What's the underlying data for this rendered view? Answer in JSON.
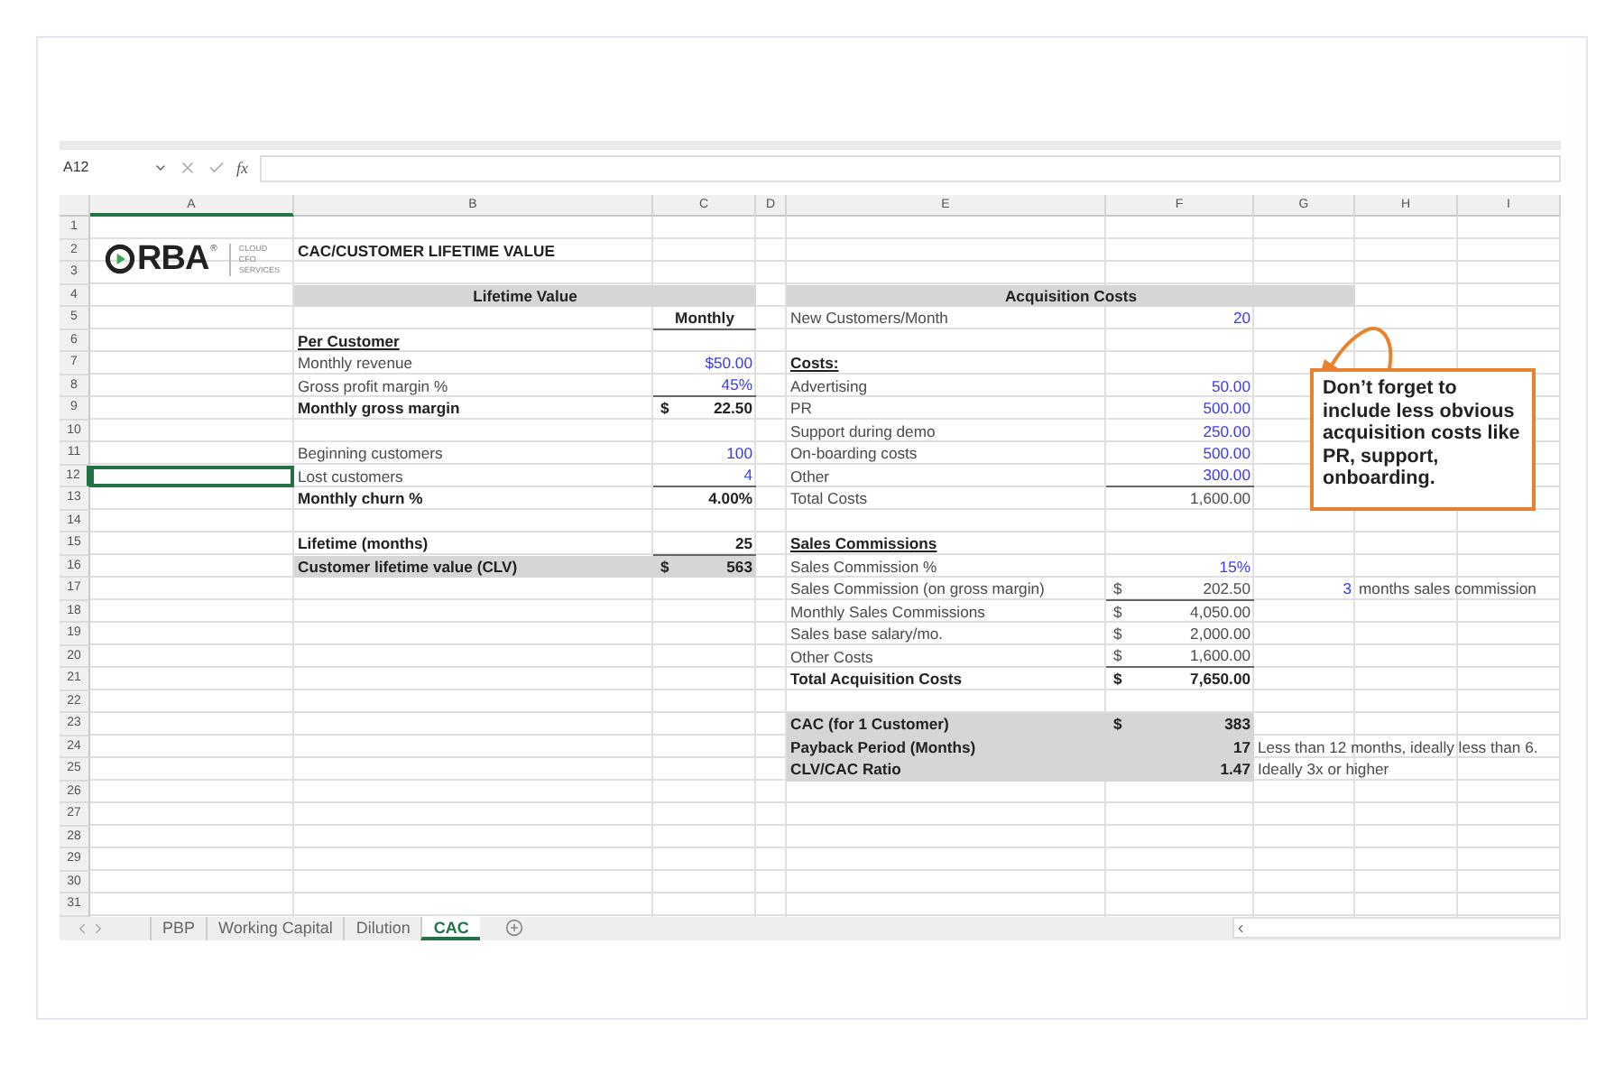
{
  "formula_bar": {
    "name_box": "A12",
    "function_label": "fx"
  },
  "columns": [
    "A",
    "B",
    "C",
    "D",
    "E",
    "F",
    "G",
    "H",
    "I"
  ],
  "logo": {
    "mark_text": "RBA",
    "registered": "®",
    "tagline": [
      "CLOUD",
      "CFO",
      "SERVICES"
    ]
  },
  "rows": [
    {
      "number": "1",
      "cells": {}
    },
    {
      "number": "2",
      "cells": {
        "B": {
          "kind": "bold",
          "text": "CAC/CUSTOMER LIFETIME VALUE"
        }
      }
    },
    {
      "number": "3",
      "cells": {}
    },
    {
      "number": "4",
      "cells": {
        "B:C": {
          "kind": "band",
          "text": "Lifetime Value",
          "shaded": true
        },
        "E:G": {
          "kind": "band",
          "text": "Acquisition Costs",
          "shaded": true
        }
      }
    },
    {
      "number": "5",
      "cells": {
        "C": {
          "kind": "band",
          "text": "Monthly",
          "underlined": true
        },
        "E": {
          "kind": "label",
          "text": "New Customers/Month"
        },
        "F": {
          "kind": "input",
          "text": "20"
        }
      }
    },
    {
      "number": "6",
      "cells": {
        "B": {
          "kind": "heading",
          "text": "Per Customer"
        }
      }
    },
    {
      "number": "7",
      "cells": {
        "B": {
          "kind": "label",
          "text": "Monthly revenue"
        },
        "C": {
          "kind": "input",
          "text": "$50.00"
        },
        "E": {
          "kind": "heading",
          "text": "Costs:"
        }
      }
    },
    {
      "number": "8",
      "cells": {
        "B": {
          "kind": "label",
          "text": "Gross profit margin %"
        },
        "C": {
          "kind": "input",
          "text": "45%",
          "underlined": true
        },
        "E": {
          "kind": "label",
          "text": "Advertising"
        },
        "F": {
          "kind": "input",
          "text": "50.00"
        }
      }
    },
    {
      "number": "9",
      "cells": {
        "B": {
          "kind": "bold",
          "text": "Monthly gross margin"
        },
        "C": {
          "kind": "bold_number",
          "currency": "$",
          "text": "22.50"
        },
        "E": {
          "kind": "label",
          "text": "PR"
        },
        "F": {
          "kind": "input",
          "text": "500.00"
        }
      }
    },
    {
      "number": "10",
      "cells": {
        "E": {
          "kind": "label",
          "text": "Support during demo"
        },
        "F": {
          "kind": "input",
          "text": "250.00"
        }
      }
    },
    {
      "number": "11",
      "cells": {
        "B": {
          "kind": "label",
          "text": "Beginning customers"
        },
        "C": {
          "kind": "input",
          "text": "100"
        },
        "E": {
          "kind": "label",
          "text": "On-boarding costs"
        },
        "F": {
          "kind": "input",
          "text": "500.00"
        }
      }
    },
    {
      "number": "12",
      "cells": {
        "B": {
          "kind": "label",
          "text": "Lost customers"
        },
        "C": {
          "kind": "input",
          "text": "4",
          "underlined": true
        },
        "E": {
          "kind": "label",
          "text": "Other"
        },
        "F": {
          "kind": "input",
          "text": "300.00",
          "underlined": true
        }
      }
    },
    {
      "number": "13",
      "cells": {
        "B": {
          "kind": "bold",
          "text": "Monthly churn %"
        },
        "C": {
          "kind": "bold_number",
          "text": "4.00%"
        },
        "E": {
          "kind": "label",
          "text": "Total Costs"
        },
        "F": {
          "kind": "number",
          "text": "1,600.00"
        }
      }
    },
    {
      "number": "14",
      "cells": {}
    },
    {
      "number": "15",
      "cells": {
        "B": {
          "kind": "bold",
          "text": "Lifetime (months)"
        },
        "C": {
          "kind": "bold_number",
          "text": "25",
          "underlined": true
        },
        "E": {
          "kind": "heading",
          "text": "Sales Commissions"
        }
      }
    },
    {
      "number": "16",
      "cells": {
        "B": {
          "kind": "bold",
          "text": "Customer lifetime value (CLV)",
          "shaded": true
        },
        "C": {
          "kind": "bold_number",
          "currency": "$",
          "text": "563",
          "shaded": true
        },
        "E": {
          "kind": "label",
          "text": "Sales Commission %"
        },
        "F": {
          "kind": "input",
          "text": "15%"
        }
      }
    },
    {
      "number": "17",
      "cells": {
        "E": {
          "kind": "label",
          "text": "Sales Commission (on gross margin)"
        },
        "F": {
          "kind": "number",
          "currency": "$",
          "text": "202.50",
          "underlined": true
        },
        "G": {
          "kind": "input",
          "text": "3"
        },
        "H:I": {
          "kind": "label",
          "text": "months sales commission"
        }
      }
    },
    {
      "number": "18",
      "cells": {
        "E": {
          "kind": "label",
          "text": "Monthly Sales Commissions"
        },
        "F": {
          "kind": "number",
          "currency": "$",
          "text": "4,050.00"
        }
      }
    },
    {
      "number": "19",
      "cells": {
        "E": {
          "kind": "label",
          "text": "Sales base salary/mo."
        },
        "F": {
          "kind": "number",
          "currency": "$",
          "text": "2,000.00"
        }
      }
    },
    {
      "number": "20",
      "cells": {
        "E": {
          "kind": "label",
          "text": "Other Costs"
        },
        "F": {
          "kind": "number",
          "currency": "$",
          "text": "1,600.00",
          "underlined": true
        }
      }
    },
    {
      "number": "21",
      "cells": {
        "E": {
          "kind": "bold",
          "text": "Total Acquisition Costs"
        },
        "F": {
          "kind": "bold_number",
          "currency": "$",
          "text": "7,650.00"
        }
      }
    },
    {
      "number": "22",
      "cells": {}
    },
    {
      "number": "23",
      "cells": {
        "E": {
          "kind": "bold",
          "text": "CAC (for 1 Customer)",
          "shaded": true
        },
        "F": {
          "kind": "bold_number",
          "currency": "$",
          "text": "383",
          "shaded": true
        }
      }
    },
    {
      "number": "24",
      "cells": {
        "E": {
          "kind": "bold",
          "text": "Payback Period (Months)",
          "shaded": true
        },
        "F": {
          "kind": "bold_number",
          "text": "17",
          "shaded": true
        },
        "G:I": {
          "kind": "label",
          "text": "Less than 12 months, ideally less than 6."
        }
      }
    },
    {
      "number": "25",
      "cells": {
        "E": {
          "kind": "bold",
          "text": "CLV/CAC Ratio",
          "shaded": true
        },
        "F": {
          "kind": "bold_number",
          "text": "1.47",
          "shaded": true
        },
        "G:I": {
          "kind": "label",
          "text": "Ideally 3x or higher"
        }
      }
    },
    {
      "number": "26",
      "cells": {}
    },
    {
      "number": "27",
      "cells": {}
    },
    {
      "number": "28",
      "cells": {}
    },
    {
      "number": "29",
      "cells": {}
    },
    {
      "number": "30",
      "cells": {}
    },
    {
      "number": "31",
      "cells": {}
    }
  ],
  "callout": {
    "text": "Don’t forget to include less obvious acquisition costs like PR, support, onboarding."
  },
  "sheet_tabs": [
    {
      "label": "PBP",
      "selected": false
    },
    {
      "label": "Working Capital",
      "selected": false
    },
    {
      "label": "Dilution",
      "selected": false
    },
    {
      "label": "CAC",
      "selected": true
    }
  ]
}
